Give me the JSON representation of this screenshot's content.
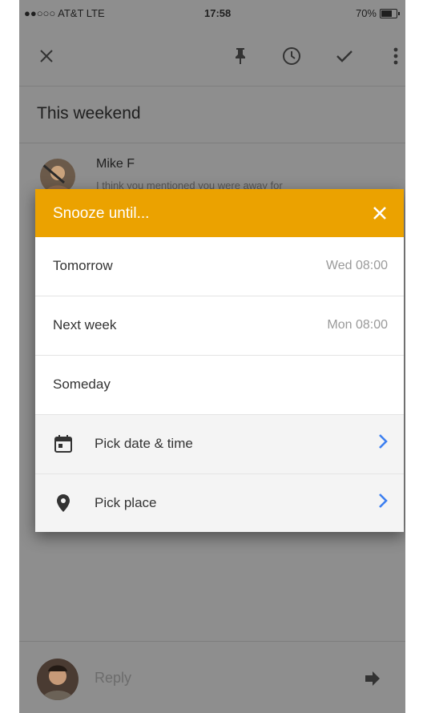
{
  "status_bar": {
    "carrier": "●●○○○ AT&T  LTE",
    "time": "17:58",
    "battery": "70%",
    "battery_level": 0.7
  },
  "toolbar": {
    "close_icon": "close-icon",
    "pin_icon": "pin-icon",
    "reminder_icon": "clock-icon",
    "done_icon": "check-icon",
    "more_icon": "more-vert-icon"
  },
  "note": {
    "title": "This weekend",
    "author": "Mike F",
    "snippet": "I think you mentioned you were away for"
  },
  "dialog": {
    "title": "Snooze until...",
    "options": [
      {
        "label": "Tomorrow",
        "time": "Wed 08:00"
      },
      {
        "label": "Next week",
        "time": "Mon 08:00"
      },
      {
        "label": "Someday",
        "time": ""
      }
    ],
    "actions": [
      {
        "label": "Pick date & time",
        "icon": "calendar-icon"
      },
      {
        "label": "Pick place",
        "icon": "location-pin-icon"
      }
    ]
  },
  "reply": {
    "placeholder": "Reply"
  },
  "colors": {
    "accent": "#eba200",
    "chevron": "#3d7ff0",
    "overlay": "#8e8e8e"
  }
}
